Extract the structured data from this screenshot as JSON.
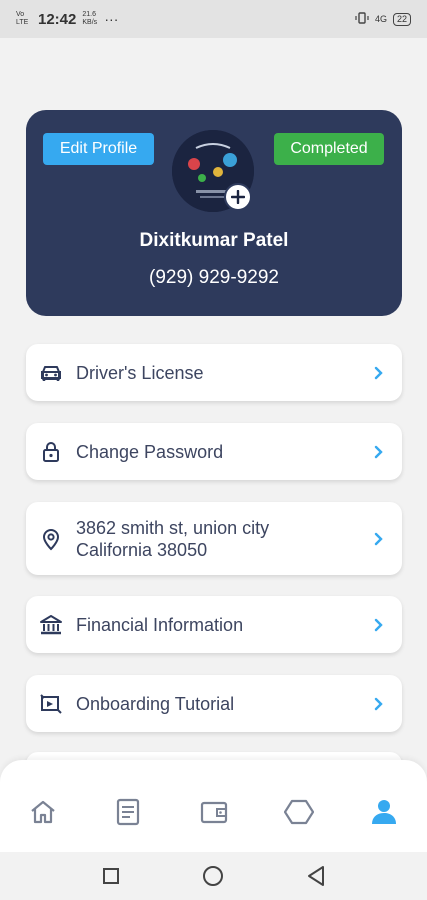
{
  "status_bar": {
    "signal": "Vo LTE",
    "time": "12:42",
    "speed": "21.6 KB/s",
    "dots": "···",
    "network": "4G",
    "battery": "22"
  },
  "profile": {
    "edit_label": "Edit Profile",
    "status_label": "Completed",
    "name": "Dixitkumar Patel",
    "phone": "(929) 929-9292"
  },
  "menu": [
    {
      "label": "Driver's License",
      "icon": "car-icon"
    },
    {
      "label": "Change Password",
      "icon": "lock-icon"
    },
    {
      "label": "3862 smith st, union city California 38050",
      "icon": "location-pin-icon"
    },
    {
      "label": "Financial Information",
      "icon": "bank-icon"
    },
    {
      "label": "Onboarding Tutorial",
      "icon": "tutorial-icon"
    }
  ],
  "bottom_nav": [
    {
      "name": "home",
      "icon": "home-icon"
    },
    {
      "name": "documents",
      "icon": "document-icon"
    },
    {
      "name": "wallet",
      "icon": "wallet-icon"
    },
    {
      "name": "hexagon",
      "icon": "hexagon-icon"
    },
    {
      "name": "profile",
      "icon": "user-icon",
      "active": true
    }
  ],
  "colors": {
    "card_bg": "#2e3a5c",
    "edit_button": "#36a9f0",
    "completed_badge": "#3cb04a",
    "chevron": "#36a9f0",
    "active_nav": "#36a9f0",
    "inactive_nav": "#7a8294"
  }
}
